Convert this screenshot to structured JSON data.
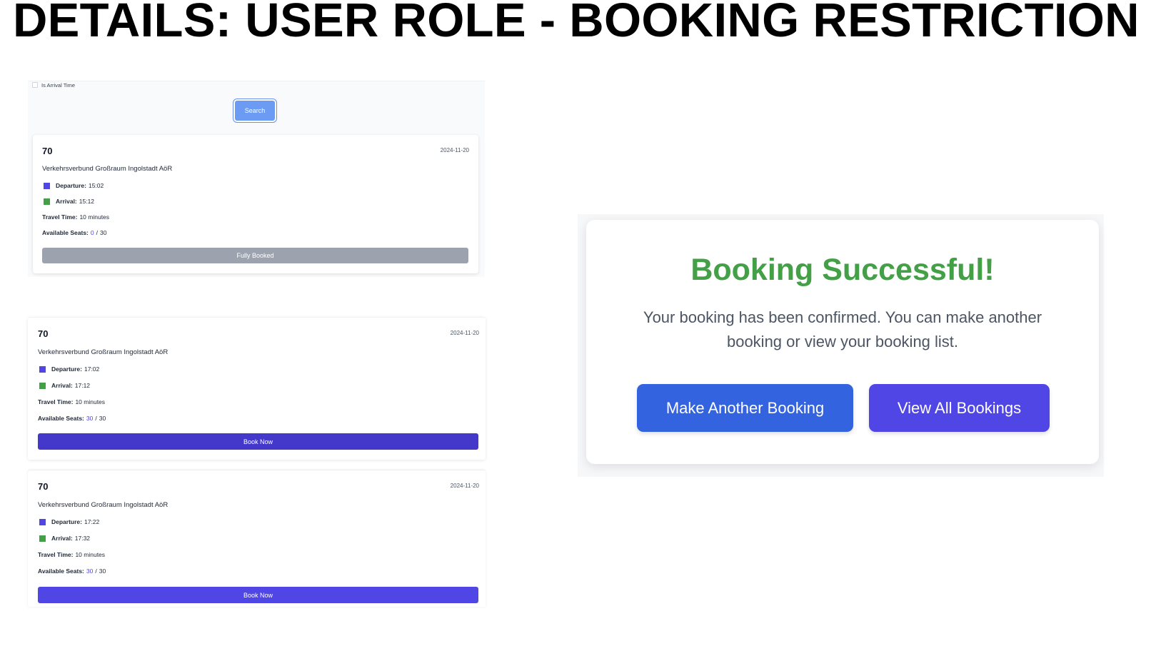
{
  "page_title": "DETAILS: USER ROLE - BOOKING RESTRICTION",
  "search_panel": {
    "arrival_checkbox_label": "Is Arrival Time",
    "search_label": "Search"
  },
  "labels": {
    "departure": "Departure:",
    "arrival": "Arrival:",
    "travel_time": "Travel Time:",
    "available_seats": "Available Seats:",
    "seats_separator": "/"
  },
  "results": [
    {
      "route": "70",
      "date": "2024-11-20",
      "operator": "Verkehrsverbund Großraum Ingolstadt AöR",
      "departure": "15:02",
      "arrival": "15:12",
      "travel_time": "10 minutes",
      "seats_available": "0",
      "seats_total": "30",
      "action_label": "Fully Booked"
    },
    {
      "route": "70",
      "date": "2024-11-20",
      "operator": "Verkehrsverbund Großraum Ingolstadt AöR",
      "departure": "17:02",
      "arrival": "17:12",
      "travel_time": "10 minutes",
      "seats_available": "30",
      "seats_total": "30",
      "action_label": "Book Now"
    },
    {
      "route": "70",
      "date": "2024-11-20",
      "operator": "Verkehrsverbund Großraum Ingolstadt AöR",
      "departure": "17:22",
      "arrival": "17:32",
      "travel_time": "10 minutes",
      "seats_available": "30",
      "seats_total": "30",
      "action_label": "Book Now"
    }
  ],
  "success_dialog": {
    "title": "Booking Successful!",
    "message": "Your booking has been confirmed. You can make another booking or view your booking list.",
    "primary_button": "Make Another Booking",
    "secondary_button": "View All Bookings"
  },
  "colors": {
    "success_green": "#43a047",
    "indigo": "#4f46e5",
    "blue": "#3463e0",
    "booked_gray": "#9ca3af"
  }
}
